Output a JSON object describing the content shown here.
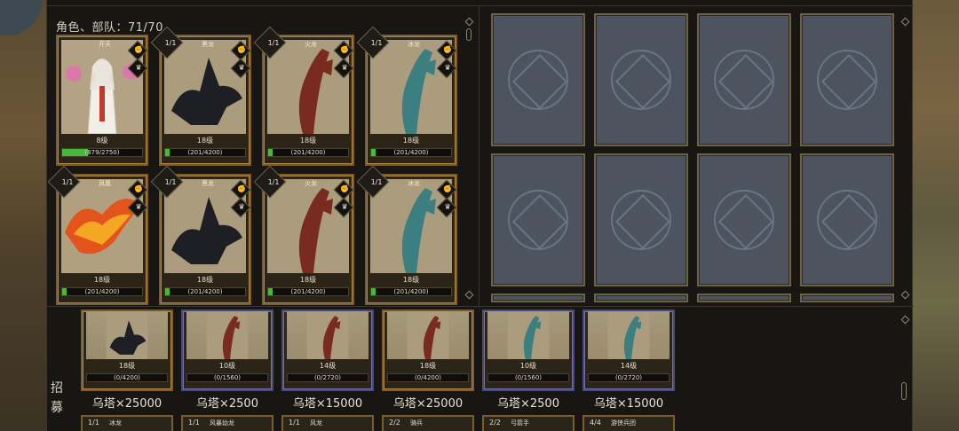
{
  "roster": {
    "count_label": "角色、部队：71/70"
  },
  "characters": [
    {
      "count": "",
      "name": "开天",
      "level": "8级",
      "xp": "(879/2750)",
      "xp_fraction": 0.32,
      "kind": "priestess",
      "badges": [
        "fist-icon",
        "crown-icon"
      ]
    },
    {
      "count": "1/1",
      "name": "黑龙",
      "level": "18级",
      "xp": "(201/4200)",
      "xp_fraction": 0.05,
      "kind": "black",
      "badges": [
        "fist-icon",
        "crown-icon"
      ]
    },
    {
      "count": "1/1",
      "name": "火龙",
      "level": "18级",
      "xp": "(201/4200)",
      "xp_fraction": 0.05,
      "kind": "red",
      "badges": [
        "fist-icon",
        "crown-icon"
      ]
    },
    {
      "count": "1/1",
      "name": "冰龙",
      "level": "18级",
      "xp": "(201/4200)",
      "xp_fraction": 0.05,
      "kind": "teal",
      "badges": [
        "fist-icon",
        "crown-icon"
      ]
    },
    {
      "count": "1/1",
      "name": "凤凰",
      "level": "18级",
      "xp": "(201/4200)",
      "xp_fraction": 0.05,
      "kind": "phoenix",
      "badges": [
        "fist-icon",
        "crown-icon"
      ]
    },
    {
      "count": "1/1",
      "name": "黑龙",
      "level": "18级",
      "xp": "(201/4200)",
      "xp_fraction": 0.05,
      "kind": "black",
      "badges": [
        "fist-icon",
        "crown-icon"
      ]
    },
    {
      "count": "1/1",
      "name": "火龙",
      "level": "18级",
      "xp": "(201/4200)",
      "xp_fraction": 0.05,
      "kind": "red",
      "badges": [
        "fist-icon",
        "crown-icon"
      ]
    },
    {
      "count": "1/1",
      "name": "冰龙",
      "level": "18级",
      "xp": "(201/4200)",
      "xp_fraction": 0.05,
      "kind": "teal",
      "badges": [
        "fist-icon",
        "crown-icon"
      ]
    }
  ],
  "recruit": {
    "label": "招募",
    "items": [
      {
        "level": "18级",
        "xp": "(0/4200)",
        "price": "乌塔×25000",
        "kind": "black",
        "frame": "gold"
      },
      {
        "level": "10级",
        "xp": "(0/1560)",
        "price": "乌塔×2500",
        "kind": "red",
        "frame": "blue"
      },
      {
        "level": "14级",
        "xp": "(0/2720)",
        "price": "乌塔×15000",
        "kind": "red",
        "frame": "blue"
      },
      {
        "level": "18级",
        "xp": "(0/4200)",
        "price": "乌塔×25000",
        "kind": "red",
        "frame": "gold"
      },
      {
        "level": "10级",
        "xp": "(0/1560)",
        "price": "乌塔×2500",
        "kind": "teal",
        "frame": "blue"
      },
      {
        "level": "14级",
        "xp": "(0/2720)",
        "price": "乌塔×15000",
        "kind": "teal",
        "frame": "blue"
      }
    ],
    "next_row": [
      {
        "count": "1/1",
        "name": "冰龙"
      },
      {
        "count": "1/1",
        "name": "风暴幼龙"
      },
      {
        "count": "1/1",
        "name": "风龙"
      },
      {
        "count": "2/2",
        "name": "骑兵"
      },
      {
        "count": "2/2",
        "name": "弓箭手"
      },
      {
        "count": "4/4",
        "name": "游侠兵团"
      }
    ]
  },
  "colors": {
    "xp_bar": "#46b83a",
    "gold_frame": "#7c5c2c",
    "blue_frame": "#4c4a7a",
    "card_back": "#4d5460"
  }
}
